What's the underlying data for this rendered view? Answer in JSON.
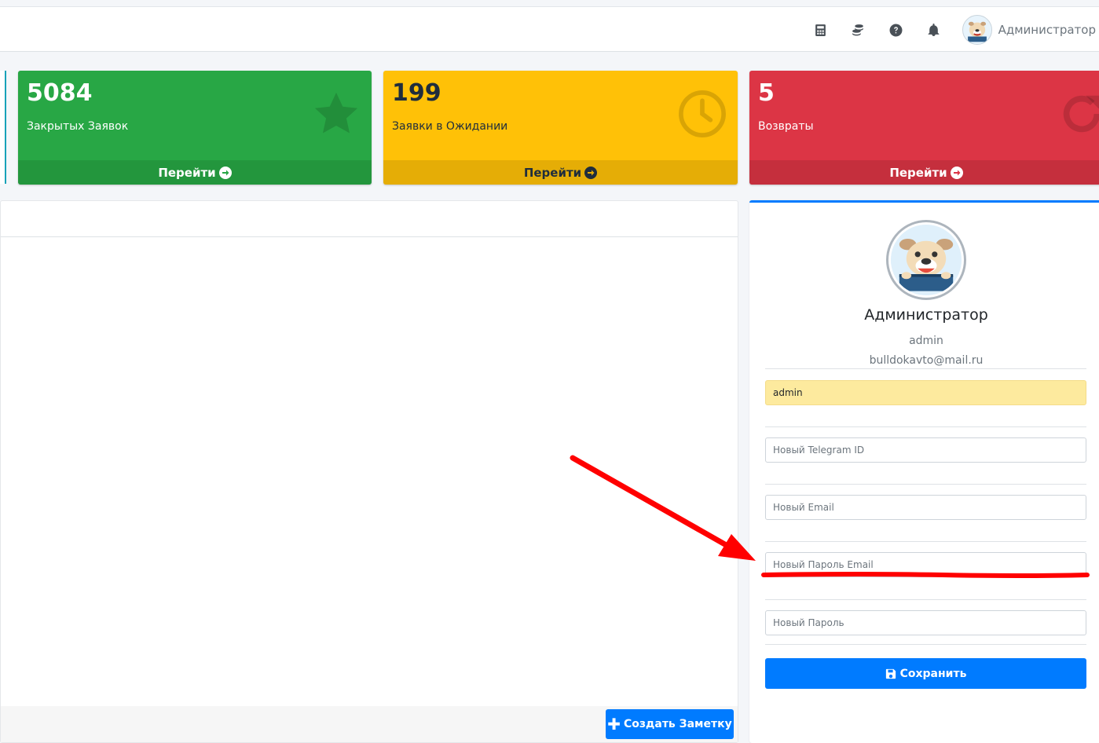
{
  "topbar": {
    "icons": [
      "calculator-icon",
      "coins-icon",
      "question-icon",
      "bell-icon"
    ],
    "username": "Администратор"
  },
  "stats": [
    {
      "value": "5084",
      "label": "Закрытых Заявок",
      "link": "Перейти",
      "color": "#28a745",
      "icon": "star-icon"
    },
    {
      "value": "199",
      "label": "Заявки в Ожидании",
      "link": "Перейти",
      "color": "#ffc107",
      "icon": "clock-icon"
    },
    {
      "value": "5",
      "label": "Возвраты",
      "link": "Перейти",
      "color": "#dc3545",
      "icon": "redo-icon"
    }
  ],
  "notes": {
    "create_label": "Создать Заметку"
  },
  "profile": {
    "name": "Администратор",
    "login": "admin",
    "email": "bulldokavto@mail.ru",
    "fields": {
      "login_value": "admin",
      "telegram_placeholder": "Новый Telegram ID",
      "email_placeholder": "Новый Email",
      "email_password_placeholder": "Новый Пароль Email",
      "password_placeholder": "Новый Пароль"
    },
    "save_label": "Сохранить"
  },
  "colors": {
    "primary": "#007bff",
    "annotation": "#ff0000"
  }
}
